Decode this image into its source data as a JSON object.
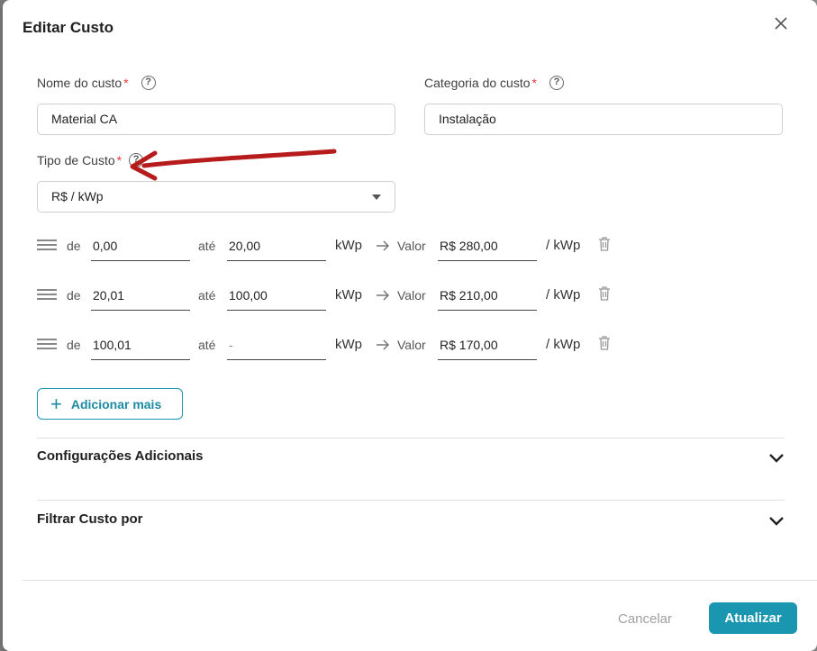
{
  "modal": {
    "title": "Editar Custo",
    "close_icon": "close-icon"
  },
  "fields": {
    "nome": {
      "label": "Nome do custo",
      "required_mark": "*",
      "value": "Material CA"
    },
    "categoria": {
      "label": "Categoria do custo",
      "required_mark": "*",
      "value": "Instalação"
    },
    "tipo": {
      "label": "Tipo de Custo",
      "required_mark": "*",
      "value": "R$ / kWp"
    }
  },
  "help_symbol": "?",
  "ranges": {
    "from_label": "de",
    "to_label": "até",
    "unit_label": "kWp",
    "value_label": "Valor",
    "per_unit_label": "/ kWp",
    "rows": [
      {
        "from": "0,00",
        "to": "20,00",
        "value": "R$ 280,00"
      },
      {
        "from": "20,01",
        "to": "100,00",
        "value": "R$ 210,00"
      },
      {
        "from": "100,01",
        "to": "-",
        "value": "R$ 170,00"
      }
    ]
  },
  "add_more": {
    "plus": "+",
    "label": "Adicionar mais"
  },
  "sections": {
    "additional": "Configurações Adicionais",
    "filter": "Filtrar Custo por"
  },
  "footer": {
    "cancel": "Cancelar",
    "update": "Atualizar"
  },
  "colors": {
    "accent": "#1a96b1",
    "required": "#e53935",
    "annotation_arrow": "#b71c1c"
  }
}
